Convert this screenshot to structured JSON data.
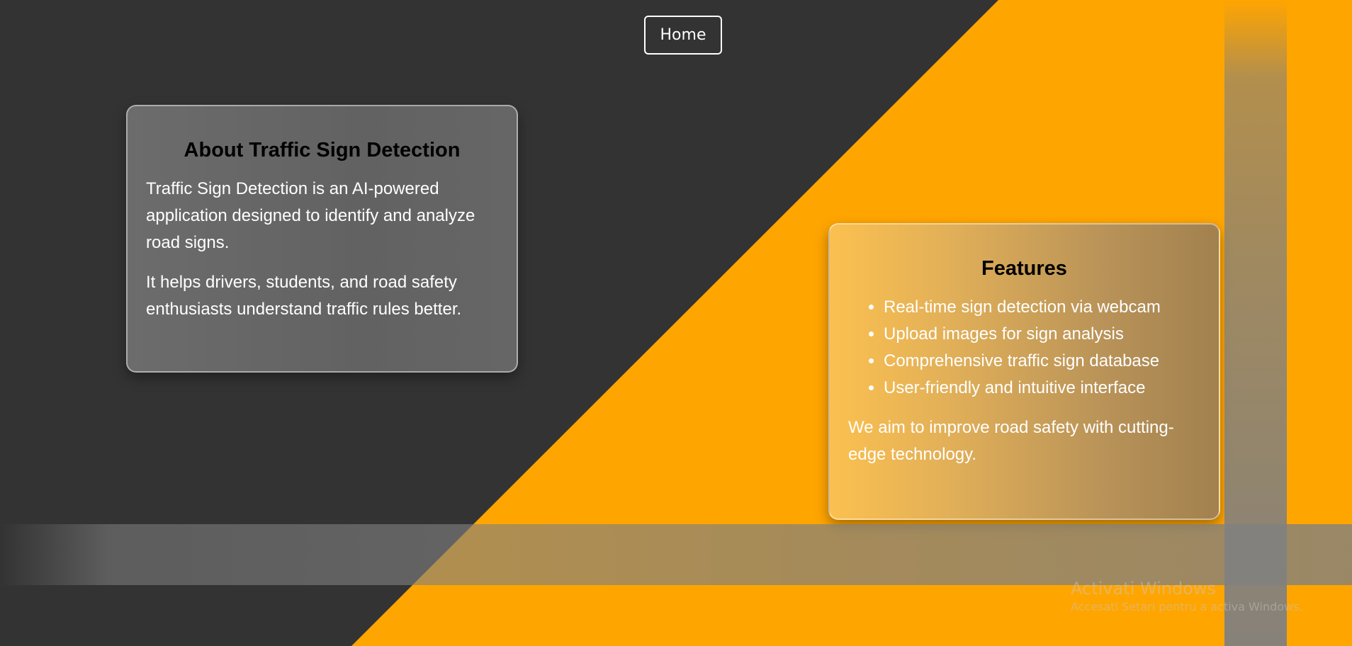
{
  "nav": {
    "home_label": "Home"
  },
  "about": {
    "title": "About Traffic Sign Detection",
    "paragraphs": [
      "Traffic Sign Detection is an AI-powered application designed to identify and analyze road signs.",
      "It helps drivers, students, and road safety enthusiasts understand traffic rules better."
    ]
  },
  "features": {
    "title": "Features",
    "items": [
      "Real-time sign detection via webcam",
      "Upload images for sign analysis",
      "Comprehensive traffic sign database",
      "User-friendly and intuitive interface"
    ],
    "closing": "We aim to improve road safety with cutting-edge technology."
  },
  "watermark": {
    "title": "Activati Windows",
    "subtitle": "Accesati Setari pentru a activa Windows."
  },
  "colors": {
    "background_dark": "#333333",
    "accent_orange": "#FFA500",
    "text_white": "#FFFFFF",
    "heading_black": "#000000"
  }
}
